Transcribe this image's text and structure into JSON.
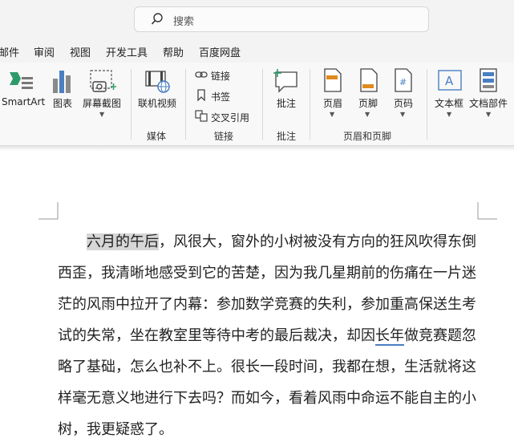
{
  "search": {
    "placeholder": "搜索"
  },
  "menu": [
    "邮件",
    "审阅",
    "视图",
    "开发工具",
    "帮助",
    "百度网盘"
  ],
  "ribbon": {
    "smartart": "SmartArt",
    "chart": "图表",
    "screenshot": "屏幕截图",
    "online_video": "联机视频",
    "link": "链接",
    "bookmark": "书签",
    "cross_ref": "交叉引用",
    "comment": "批注",
    "header": "页眉",
    "footer": "页脚",
    "page_number": "页码",
    "text_box": "文本框",
    "doc_parts": "文档部件",
    "groups": {
      "media": "媒体",
      "links": "链接",
      "comments": "批注",
      "header_footer": "页眉和页脚"
    }
  },
  "document": {
    "highlight": "六月的午后",
    "line1_rest": "，风很大，窗外的小树被没有方向的狂风吹得东倒",
    "line2": "西歪，我清晰地感受到它的苦楚，因为我几星期前的伤痛在一片迷",
    "line3": "茫的风雨中拉开了内幕：参加数学竞赛的失利，参加重高保送生考",
    "line4_a": "试的失常，坐在教室里等待中考的最后裁决，却因",
    "line4_ul": "长年",
    "line4_b": "做竞赛题忽",
    "line5": "略了基础，怎么也补不上。很长一段时间，我都在想，生活就将这",
    "line6": "样毫无意义地进行下去吗？而如今，看着风雨中命运不能自主的小",
    "line7": "树，我更疑惑了。"
  }
}
